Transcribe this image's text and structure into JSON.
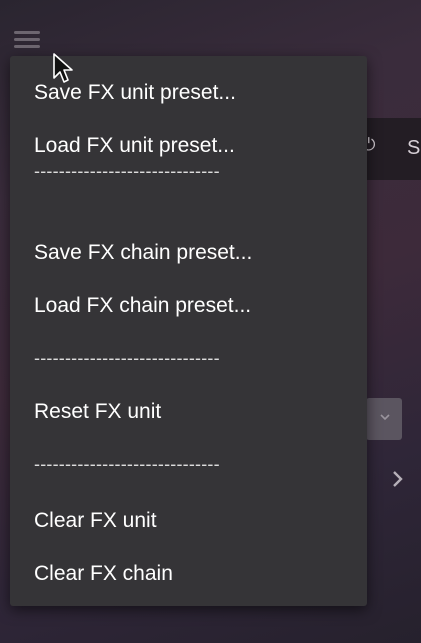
{
  "menu": {
    "items": [
      {
        "type": "item",
        "label": "Save FX unit preset..."
      },
      {
        "type": "item",
        "label": "Load FX unit preset..."
      },
      {
        "type": "separator",
        "label": "------------------------------"
      },
      {
        "type": "item",
        "label": "Save FX chain preset..."
      },
      {
        "type": "item",
        "label": "Load FX chain preset..."
      },
      {
        "type": "separator",
        "label": "------------------------------"
      },
      {
        "type": "item",
        "label": "Reset FX unit"
      },
      {
        "type": "separator",
        "label": "------------------------------"
      },
      {
        "type": "item",
        "label": "Clear FX unit"
      },
      {
        "type": "item",
        "label": "Clear FX chain"
      }
    ]
  },
  "background": {
    "header_letter": "S",
    "power_icon": "power-icon",
    "dropdown_icon": "chevron-down-icon",
    "nav_icon": "chevron-right-icon"
  },
  "colors": {
    "menu_bg": "#353437",
    "menu_text": "#ffffff",
    "page_bg": "#3a2c3c"
  }
}
